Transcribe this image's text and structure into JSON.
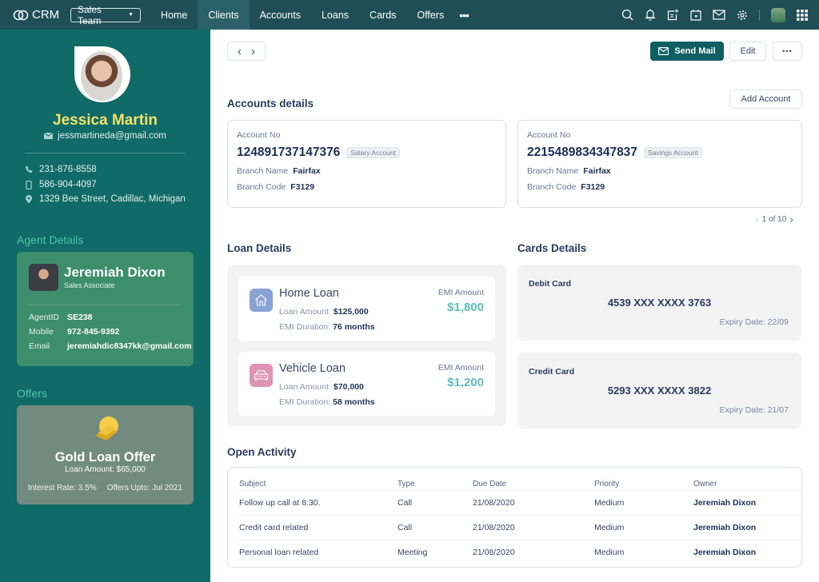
{
  "topbar": {
    "logo_text": "CRM",
    "team_select": "Sales Team",
    "nav": [
      "Home",
      "Clients",
      "Accounts",
      "Loans",
      "Cards",
      "Offers"
    ],
    "active_nav": "Clients",
    "more_label": "•••",
    "icons": [
      "search-icon",
      "bell-icon",
      "add-note-icon",
      "calendar-icon",
      "mail-icon",
      "gear-icon",
      "user-avatar",
      "apps-grid-icon"
    ]
  },
  "profile": {
    "name": "Jessica Martin",
    "email": "jessmartineda@gmail.com",
    "phone": "231-876-8558",
    "mobile": "586-904-4097",
    "address": "1329  Bee Street, Cadillac, Michigan"
  },
  "agent": {
    "section_title": "Agent Details",
    "name": "Jeremiah Dixon",
    "role": "Sales Associate",
    "id_label": "AgentID",
    "id_value": "SE238",
    "mobile_label": "Mobile",
    "mobile_value": "972-845-9392",
    "email_label": "Email",
    "email_value": "jeremiahdic8347kk@gmail.com"
  },
  "offers": {
    "section_title": "Offers",
    "title": "Gold Loan Offer",
    "amount": "Loan Amount: $65,000",
    "interest": "Interest Rate: 3.5%",
    "upto": "Offers Upto: Jul 2021"
  },
  "actions": {
    "send_mail": "Send Mail",
    "edit": "Edit",
    "more": "•••",
    "prev": "‹",
    "next": "›"
  },
  "accounts": {
    "title": "Accounts details",
    "add_button": "Add Account",
    "items": [
      {
        "label": "Account No",
        "number": "124891737147376",
        "type": "Salary Account",
        "branch_name_label": "Branch Name",
        "branch_name": "Fairfax",
        "branch_code_label": "Branch Code",
        "branch_code": "F3129"
      },
      {
        "label": "Account No",
        "number": "2215489834347837",
        "type": "Savings Account",
        "branch_name_label": "Branch Name",
        "branch_name": "Fairfax",
        "branch_code_label": "Branch Code",
        "branch_code": "F3129"
      }
    ],
    "pager": "1 of 10"
  },
  "loans": {
    "title": "Loan Details",
    "items": [
      {
        "name": "Home Loan",
        "amount_label": "Loan Amount",
        "amount": "$125,000",
        "duration_label": "EMI Duration:",
        "duration": "76 months",
        "emi_label": "EMI Amount",
        "emi": "$1,800",
        "color": "#8aa3d4"
      },
      {
        "name": "Vehicle Loan",
        "amount_label": "Loan Amount",
        "amount": "$70,000",
        "duration_label": "EMI Duration:",
        "duration": "58 months",
        "emi_label": "EMI Amount",
        "emi": "$1,200",
        "color": "#de94b2"
      }
    ]
  },
  "cards": {
    "title": "Cards Details",
    "items": [
      {
        "type": "Debit Card",
        "number": "4539 XXX XXXX 3763",
        "expiry": "Expiry Date: 22/09"
      },
      {
        "type": "Credit Card",
        "number": "5293 XXX XXXX 3822",
        "expiry": "Expiry Date: 21/07"
      }
    ]
  },
  "activity": {
    "title": "Open Activity",
    "columns": [
      "Subject",
      "Type",
      "Due Date",
      "Priority",
      "Owner"
    ],
    "rows": [
      [
        "Follow up call at 8:30.",
        "Call",
        "21/08/2020",
        "Medium",
        "Jeremiah Dixon"
      ],
      [
        "Credit card related",
        "Call",
        "21/08/2020",
        "Medium",
        "Jeremiah Dixon"
      ],
      [
        "Personal loan related",
        "Meeting",
        "21/08/2020",
        "Medium",
        "Jeremiah Dixon"
      ]
    ]
  },
  "colors": {
    "topbar": "#1f4e57",
    "sidebar": "#0f6a68",
    "accent": "#0e5f63",
    "name_yellow": "#f3e36a",
    "section_green": "#53c3a8",
    "emi_teal": "#5cbfbc"
  }
}
